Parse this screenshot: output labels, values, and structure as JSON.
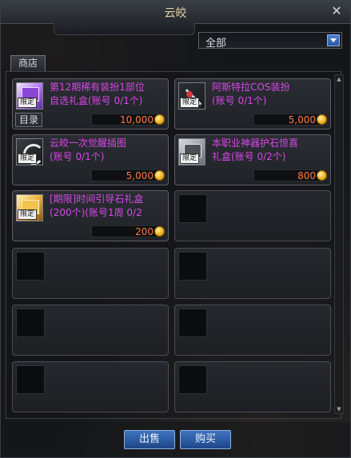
{
  "window": {
    "title": "云皎"
  },
  "filter": {
    "selected": "全部"
  },
  "tabs": {
    "shop": "商店"
  },
  "items": [
    {
      "name": "第12期稀有装扮1部位\n自选礼盒(账号 0/1个)",
      "price": "10,000",
      "badge": "限定",
      "catalog": "目录",
      "icon": "purple-gift-box-icon"
    },
    {
      "name": "阿斯特拉COS装扮\n(账号 0/1个)",
      "price": "5,000",
      "badge": "限定",
      "icon": "weapon-icon"
    },
    {
      "name": "云皎一次觉醒插图\n(账号 0/1个)",
      "price": "5,000",
      "badge": "限定",
      "icon": "illustration-icon"
    },
    {
      "name": "本职业神器护石惊喜\n礼盒(账号 0/2个)",
      "price": "800",
      "badge": "限定",
      "icon": "artifact-box-icon"
    },
    {
      "name": "[期限]时间引导石礼盒\n(200个)(账号1周 0/2",
      "price": "200",
      "badge": "限定",
      "icon": "gold-box-icon"
    }
  ],
  "buttons": {
    "sell": "出售",
    "buy": "购买"
  },
  "colors": {
    "item_name": "#d848e8",
    "price": "#ff7a3c",
    "title": "#e2d4a6"
  }
}
